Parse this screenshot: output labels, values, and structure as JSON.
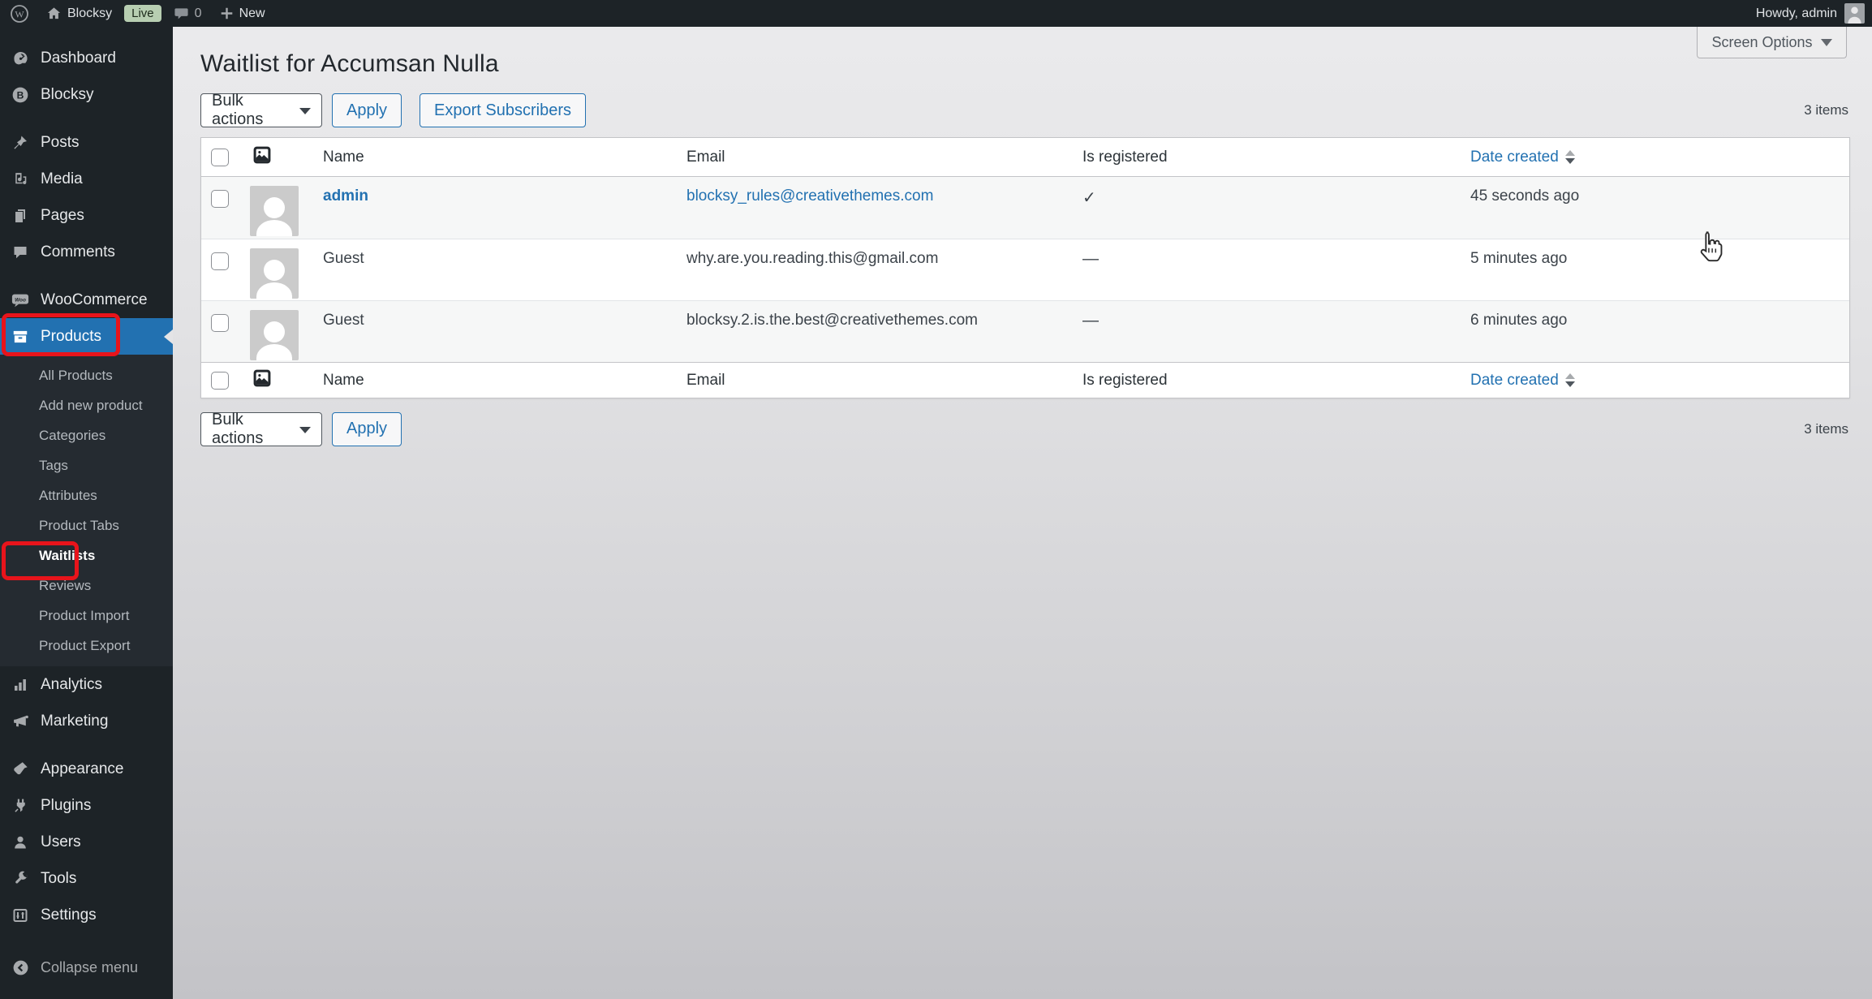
{
  "admin_bar": {
    "logo_letter": "W",
    "site_name": "Blocksy",
    "live_badge": "Live",
    "comment_count": "0",
    "new_label": "New",
    "howdy": "Howdy, admin"
  },
  "sidebar": {
    "items": [
      {
        "label": "Dashboard",
        "icon": "dashboard-icon"
      },
      {
        "label": "Blocksy",
        "icon": "blocksy-icon",
        "glyph": "B"
      },
      {
        "label": "Posts",
        "icon": "pin-icon"
      },
      {
        "label": "Media",
        "icon": "media-icon"
      },
      {
        "label": "Pages",
        "icon": "pages-icon"
      },
      {
        "label": "Comments",
        "icon": "comments-icon"
      },
      {
        "label": "WooCommerce",
        "icon": "woocommerce-icon",
        "glyph": "Woo"
      },
      {
        "label": "Products",
        "icon": "products-icon"
      },
      {
        "label": "Analytics",
        "icon": "analytics-icon"
      },
      {
        "label": "Marketing",
        "icon": "marketing-icon"
      },
      {
        "label": "Appearance",
        "icon": "appearance-icon"
      },
      {
        "label": "Plugins",
        "icon": "plugins-icon"
      },
      {
        "label": "Users",
        "icon": "users-icon"
      },
      {
        "label": "Tools",
        "icon": "tools-icon"
      },
      {
        "label": "Settings",
        "icon": "settings-icon"
      }
    ],
    "products_submenu": [
      "All Products",
      "Add new product",
      "Categories",
      "Tags",
      "Attributes",
      "Product Tabs",
      "Waitlists",
      "Reviews",
      "Product Import",
      "Product Export"
    ],
    "active_item": "Products",
    "active_submenu_item": "Waitlists",
    "collapse_label": "Collapse menu"
  },
  "page": {
    "title": "Waitlist for Accumsan Nulla",
    "screen_options_label": "Screen Options",
    "items_count": "3 items",
    "bulk_actions_label": "Bulk actions",
    "apply_label": "Apply",
    "export_label": "Export Subscribers"
  },
  "table": {
    "headers": {
      "name": "Name",
      "email": "Email",
      "registered": "Is registered",
      "date": "Date created"
    },
    "rows": [
      {
        "name": "admin",
        "email": "blocksy_rules@creativethemes.com",
        "registered_glyph": "✓",
        "date": "45 seconds ago"
      },
      {
        "name": "Guest",
        "email": "why.are.you.reading.this@gmail.com",
        "registered_glyph": "—",
        "date": "5 minutes ago"
      },
      {
        "name": "Guest",
        "email": "blocksy.2.is.the.best@creativethemes.com",
        "registered_glyph": "—",
        "date": "6 minutes ago"
      }
    ]
  },
  "colors": {
    "accent_blue": "#2271b1",
    "annotation_red": "#e8141b",
    "admin_bar_bg": "#1d2327",
    "menu_bg": "#1d2327",
    "submenu_bg": "#252b31",
    "live_badge_bg": "#b7ceb1",
    "row_stripe": "#f6f7f7"
  }
}
